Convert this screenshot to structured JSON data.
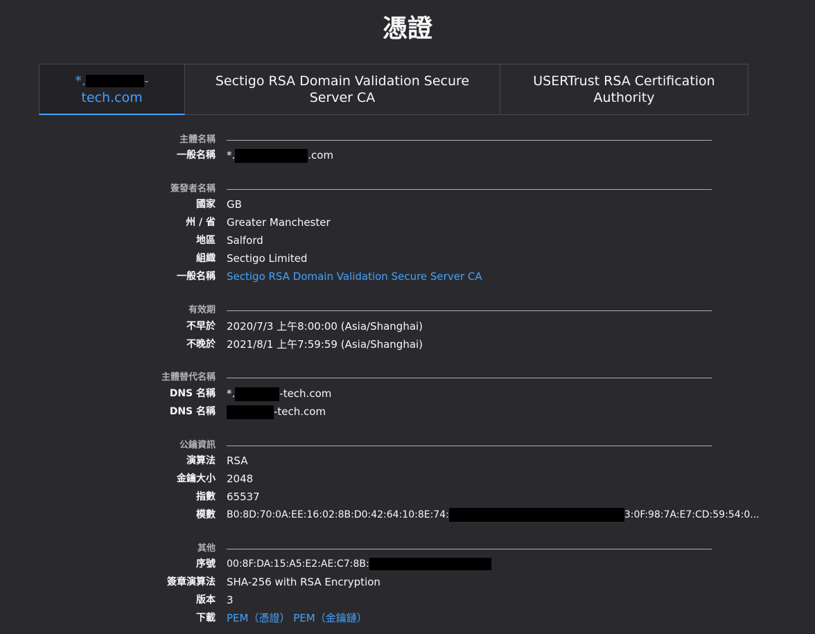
{
  "page_title": "憑證",
  "tabs": [
    {
      "label_prefix": "*.",
      "label_suffix": "-",
      "label_line2": "tech.com"
    },
    {
      "label": "Sectigo RSA Domain Validation Secure Server CA"
    },
    {
      "label": "USERTrust RSA Certification Authority"
    }
  ],
  "subject": {
    "title": "主體名稱",
    "common_name_label": "一般名稱",
    "common_name_prefix": "*.",
    "common_name_suffix": ".com"
  },
  "issuer": {
    "title": "簽發者名稱",
    "country_label": "國家",
    "country": "GB",
    "state_label": "州 / 省",
    "state": "Greater Manchester",
    "locality_label": "地區",
    "locality": "Salford",
    "org_label": "組織",
    "org": "Sectigo Limited",
    "common_name_label": "一般名稱",
    "common_name": "Sectigo RSA Domain Validation Secure Server CA"
  },
  "validity": {
    "title": "有效期",
    "not_before_label": "不早於",
    "not_before": "2020/7/3 上午8:00:00 (Asia/Shanghai)",
    "not_after_label": "不晚於",
    "not_after": "2021/8/1 上午7:59:59 (Asia/Shanghai)"
  },
  "san": {
    "title": "主體替代名稱",
    "dns_label": "DNS 名稱",
    "dns1_prefix": "*.",
    "dns1_suffix": "-tech.com",
    "dns2_suffix": "-tech.com"
  },
  "public_key": {
    "title": "公鑰資訊",
    "algorithm_label": "演算法",
    "algorithm": "RSA",
    "key_size_label": "金鑰大小",
    "key_size": "2048",
    "exponent_label": "指數",
    "exponent": "65537",
    "modulus_label": "模數",
    "modulus_prefix": "B0:8D:70:0A:EE:16:02:8B:D0:42:64:10:8E:74:",
    "modulus_suffix": "3:0F:98:7A:E7:CD:59:54:0..."
  },
  "misc": {
    "title": "其他",
    "serial_label": "序號",
    "serial_prefix": "00:8F:DA:15:A5:E2:AE:C7:8B:",
    "sig_alg_label": "簽章演算法",
    "sig_alg": "SHA-256 with RSA Encryption",
    "version_label": "版本",
    "version": "3",
    "download_label": "下載",
    "download_cert": "PEM（憑證）",
    "download_chain": "PEM（金鑰鏈）"
  },
  "colors": {
    "background": "#2a2a2e",
    "accent": "#45a1ff",
    "text": "#f9f9fa",
    "muted": "#b1b1b3"
  }
}
